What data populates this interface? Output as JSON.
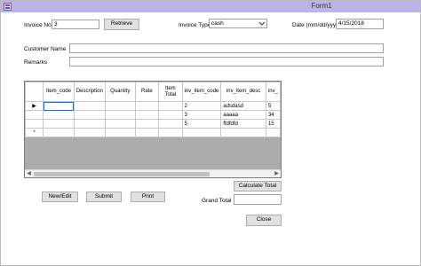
{
  "window": {
    "title": "Form1"
  },
  "invoice_no": {
    "label": "Invoice No",
    "value": "3"
  },
  "retrieve_label": "Retrieve",
  "invoice_type": {
    "label": "Invoice Type",
    "value": "cash"
  },
  "date": {
    "label": "Date (mm/dd/yyyy)",
    "value": "4/15/2018"
  },
  "customer_name": {
    "label": "Customer Name",
    "value": ""
  },
  "remarks": {
    "label": "Remarks",
    "value": ""
  },
  "grid": {
    "columns": [
      "Item_code",
      "Description",
      "Quantity",
      "Rate",
      "Item Total",
      "inv_item_code",
      "inv_item_desc",
      "inv_"
    ],
    "rows": [
      [
        "",
        "",
        "",
        "",
        "",
        "2",
        "adsdasd",
        "5"
      ],
      [
        "",
        "",
        "",
        "",
        "",
        "3",
        "aaaaa",
        "34"
      ],
      [
        "",
        "",
        "",
        "",
        "",
        "5",
        "ffdfdfd",
        "15"
      ],
      [
        "",
        "",
        "",
        "",
        "",
        "",
        "",
        ""
      ]
    ],
    "row_markers": [
      "▶",
      "",
      "",
      "*"
    ]
  },
  "buttons": {
    "new_edit": "New/Edit",
    "submit": "Submit",
    "print": "Print",
    "calculate_total": "Calculate Total",
    "close": "Close"
  },
  "grand_total": {
    "label": "Grand Total",
    "value": ""
  }
}
